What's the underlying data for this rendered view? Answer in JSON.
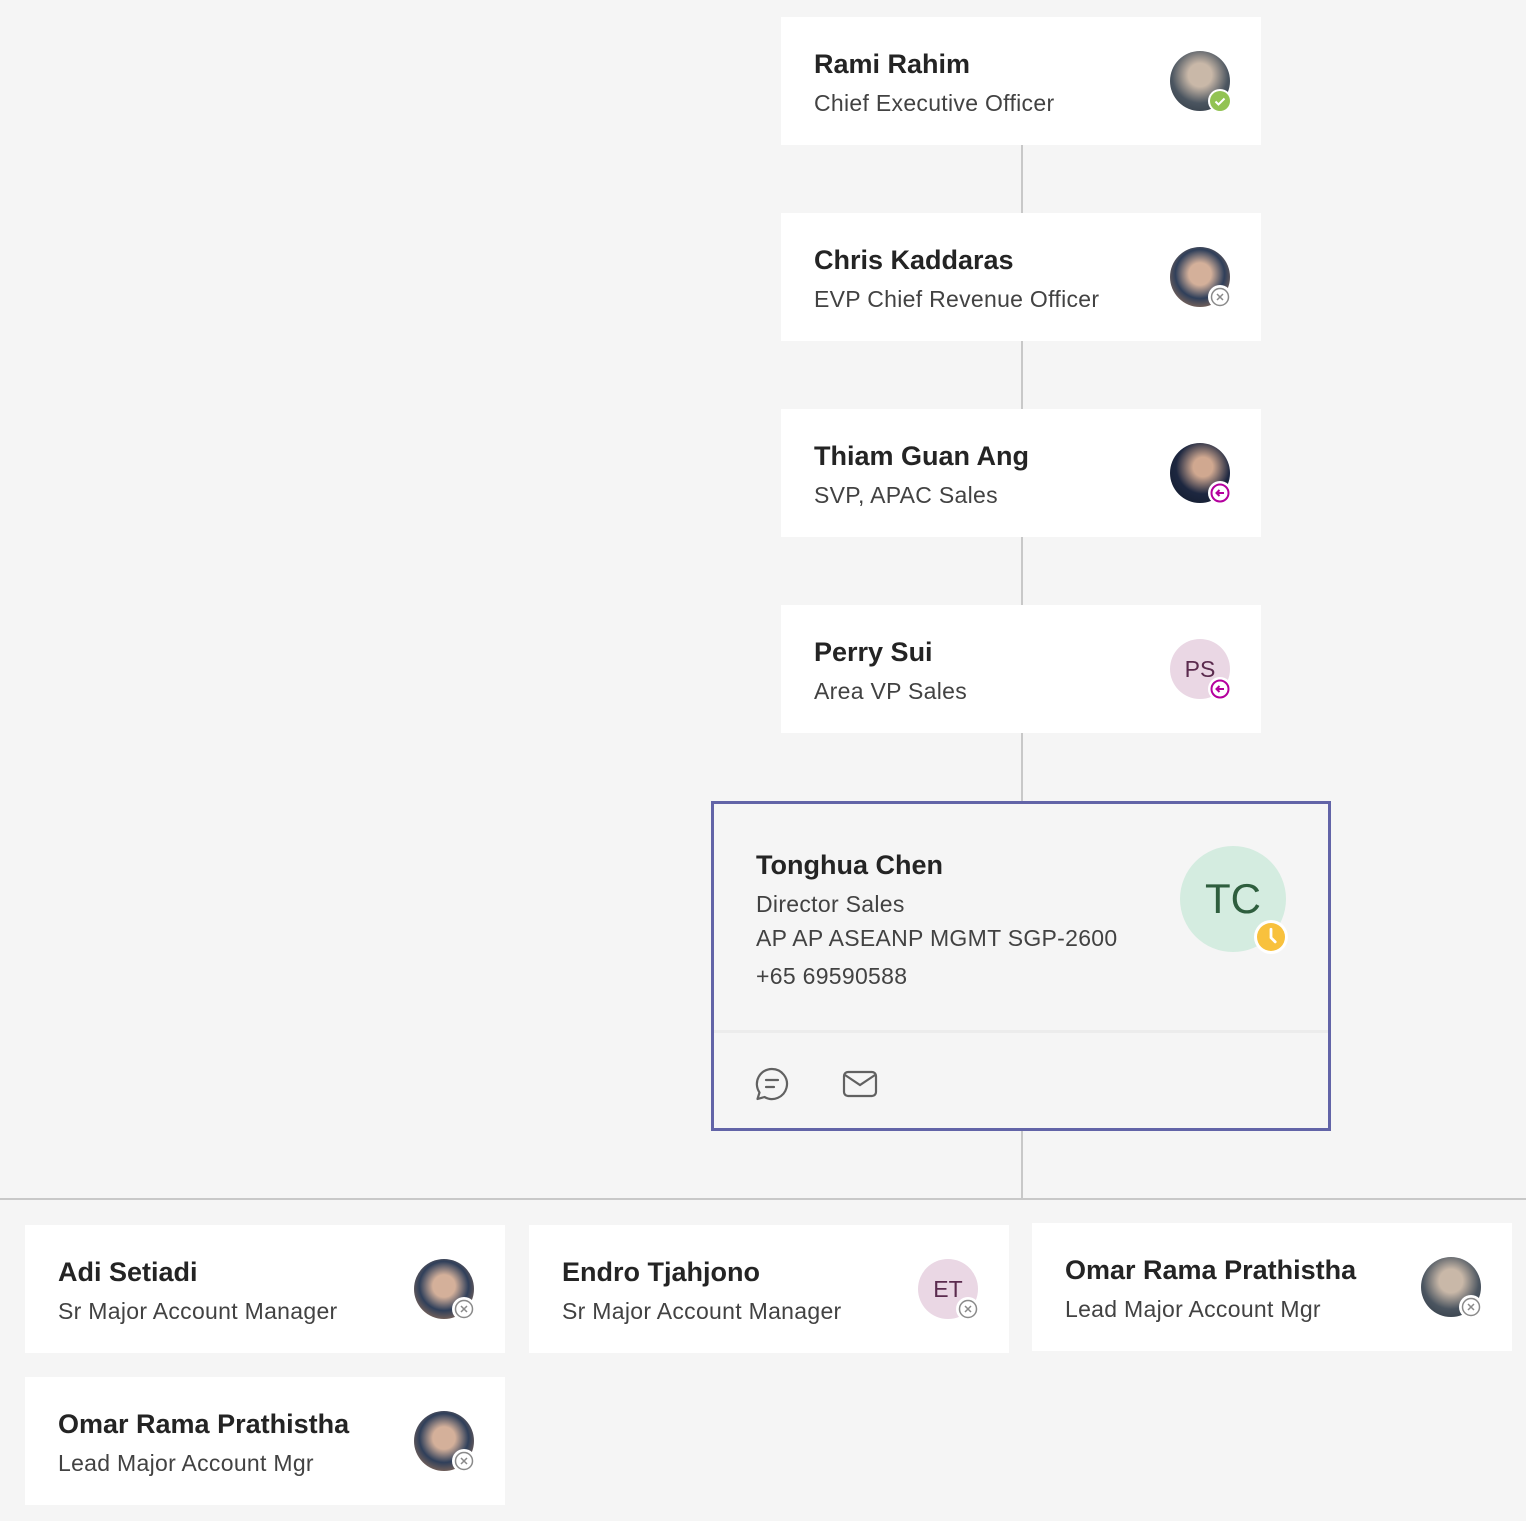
{
  "managers": [
    {
      "name": "Rami Rahim",
      "title": "Chief Executive Officer",
      "status": "available",
      "avatar": "photo"
    },
    {
      "name": "Chris Kaddaras",
      "title": "EVP Chief Revenue Officer",
      "status": "offline",
      "avatar": "photo"
    },
    {
      "name": "Thiam Guan Ang",
      "title": "SVP, APAC Sales",
      "status": "out-of-office",
      "avatar": "photo"
    },
    {
      "name": "Perry Sui",
      "title": "Area VP Sales",
      "status": "out-of-office",
      "initials": "PS"
    }
  ],
  "selected": {
    "name": "Tonghua Chen",
    "title": "Director Sales",
    "department": "AP AP ASEANP MGMT SGP-2600",
    "phone": "+65 69590588",
    "initials": "TC",
    "status": "away",
    "actions": [
      "chat-icon",
      "mail-icon"
    ]
  },
  "reports": [
    {
      "name": "Adi Setiadi",
      "title": "Sr Major Account Manager",
      "status": "offline",
      "avatar": "photo"
    },
    {
      "name": "Endro Tjahjono",
      "title": "Sr Major Account Manager",
      "status": "offline",
      "initials": "ET"
    },
    {
      "name": "Omar Rama Prathistha",
      "title": "Lead Major Account Mgr",
      "status": "offline",
      "avatar": "photo"
    },
    {
      "name": "Omar Rama Prathistha",
      "title": "Lead Major Account Mgr",
      "status": "offline",
      "avatar": "photo"
    }
  ],
  "colors": {
    "accent": "#6264a7",
    "available": "#92c353",
    "away": "#f8c13d",
    "ooo": "#b4009e",
    "offline": "#8a8a8a"
  }
}
